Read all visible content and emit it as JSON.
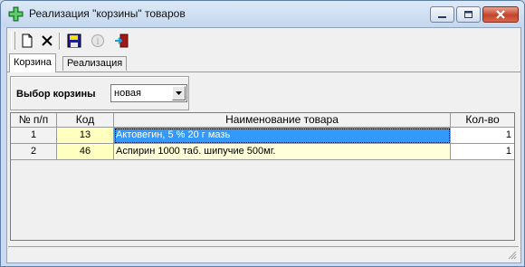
{
  "window": {
    "title": "Реализация \"корзины\" товаров"
  },
  "toolbar": {
    "buttons": [
      {
        "icon": "new-document-icon"
      },
      {
        "icon": "delete-icon"
      },
      {
        "icon": "save-icon"
      },
      {
        "icon": "info-icon"
      },
      {
        "icon": "exit-door-icon"
      }
    ]
  },
  "tabs": [
    {
      "label": "Корзина",
      "active": true
    },
    {
      "label": "Реализация",
      "active": false
    }
  ],
  "basket_selector": {
    "label": "Выбор корзины",
    "value": "новая"
  },
  "grid": {
    "columns": [
      "№ п/п",
      "Код",
      "Наименование товара",
      "Кол-во"
    ],
    "rows": [
      {
        "num": "1",
        "code": "13",
        "name": "Актовегин, 5 % 20 г мазь",
        "qty": "1",
        "selected": true
      },
      {
        "num": "2",
        "code": "46",
        "name": "Аспирин 1000 таб. шипучие 500мг.",
        "qty": "1",
        "selected": false
      }
    ]
  },
  "colors": {
    "selection": "#3399ff",
    "code_cell": "#ffffbf",
    "name_cell": "#ffffd9",
    "titlebar": "#c4d7ee"
  }
}
